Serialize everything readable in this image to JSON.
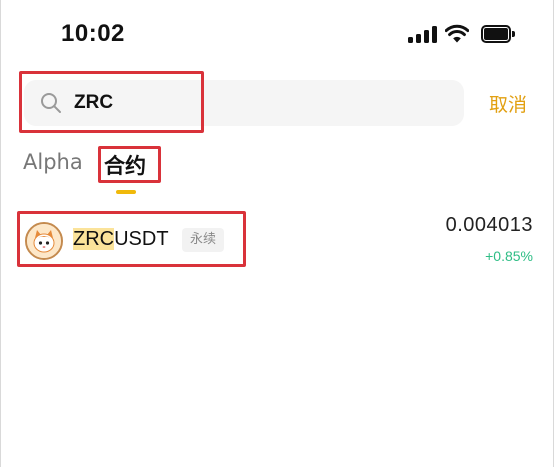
{
  "status_bar": {
    "time": "10:02",
    "icons": [
      "cellular-signal-icon",
      "wifi-icon",
      "battery-icon"
    ]
  },
  "search": {
    "value": "ZRC",
    "placeholder": "",
    "icon": "search-icon",
    "cancel_label": "取消"
  },
  "tabs": [
    {
      "label": "Alpha",
      "active": false
    },
    {
      "label": "合约",
      "active": true
    }
  ],
  "results": [
    {
      "symbol_match": "ZRC",
      "symbol_rest": "USDT",
      "badge": "永续",
      "price": "0.004013",
      "change": "+0.85%"
    }
  ],
  "colors": {
    "accent": "#f0b90b",
    "cancel": "#e2a012",
    "positive": "#2ebd85",
    "highlight": "#fbe39a",
    "annotation": "#d9323a"
  }
}
